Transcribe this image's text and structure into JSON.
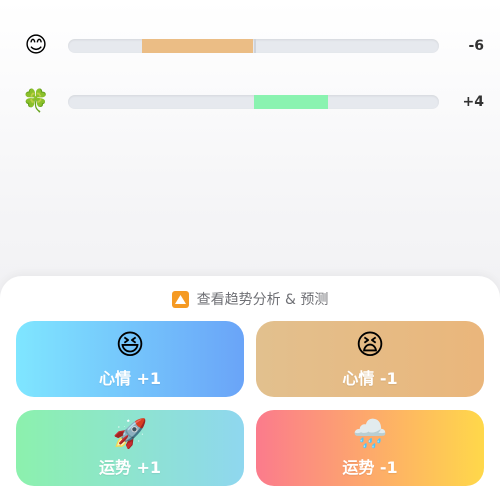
{
  "stats": [
    {
      "emoji": "😊",
      "icon": "smile-icon",
      "value_label": "-6",
      "value": -6,
      "color": "#ebbd85"
    },
    {
      "emoji": "🍀",
      "icon": "clover-icon",
      "value_label": "+4",
      "value": 4,
      "color": "#8af3b0"
    }
  ],
  "trend": {
    "label": "查看趋势分析 & 预测",
    "icon_color": "#f59a23"
  },
  "buttons": [
    {
      "emoji": "😆",
      "icon": "laughing-face-icon",
      "label": "心情 +1",
      "gradient": [
        "#7fe6ff",
        "#6aa4f8"
      ]
    },
    {
      "emoji": "😫",
      "icon": "tired-face-icon",
      "label": "心情 -1",
      "gradient": [
        "#e2c08e",
        "#eab67b"
      ]
    },
    {
      "emoji": "🚀",
      "icon": "rocket-icon",
      "label": "运势 +1",
      "gradient": [
        "#8cf1ad",
        "#8fd7ef"
      ]
    },
    {
      "emoji": "🌧️",
      "icon": "rain-cloud-icon",
      "label": "运势 -1",
      "gradient": [
        "#fb7b8c",
        "#ffd84a"
      ]
    }
  ]
}
